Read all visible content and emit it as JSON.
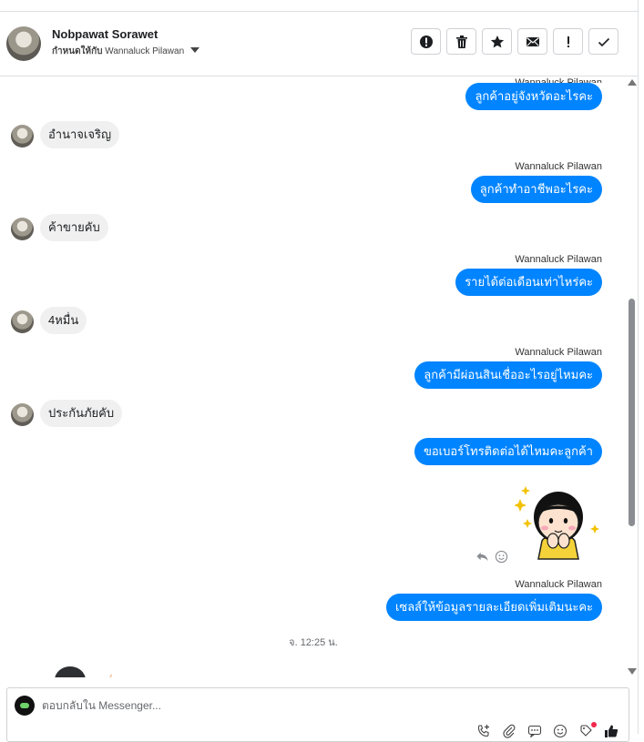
{
  "header": {
    "name": "Nobpawat Sorawet",
    "assign_label": "กำหนดให้กับ",
    "assignee": "Wannaluck Pilawan"
  },
  "actions": [
    {
      "icon": "spam-alert-icon"
    },
    {
      "icon": "trash-icon"
    },
    {
      "icon": "star-icon"
    },
    {
      "icon": "mail-icon"
    },
    {
      "icon": "exclamation-icon"
    },
    {
      "icon": "check-icon"
    }
  ],
  "conversation": {
    "partial_sender": "Wannaluck Pilawan",
    "messages": [
      {
        "from": "agent",
        "text": "ลูกค้าอยู่จังหวัดอะไรคะ"
      },
      {
        "from": "customer",
        "text": "อำนาจเจริญ"
      },
      {
        "from": "agent",
        "sender": "Wannaluck Pilawan",
        "text": "ลูกค้าทำอาชีพอะไรคะ"
      },
      {
        "from": "customer",
        "text": "ค้าขายคับ"
      },
      {
        "from": "agent",
        "sender": "Wannaluck Pilawan",
        "text": "รายได้ต่อเดือนเท่าไหร่คะ"
      },
      {
        "from": "customer",
        "text": "4หมื่น"
      },
      {
        "from": "agent",
        "sender": "Wannaluck Pilawan",
        "text": "ลูกค้ามีผ่อนสินเชื่ออะไรอยู่ไหมคะ"
      },
      {
        "from": "customer",
        "text": "ประกันภัยคับ"
      },
      {
        "from": "agent",
        "text": "ขอเบอร์โทรติดต่อได้ไหมคะลูกค้า"
      },
      {
        "from": "agent",
        "sender": "Wannaluck Pilawan",
        "text": "เซลส์ให้ข้อมูลรายละเอียดเพิ่มเติมนะคะ"
      }
    ],
    "timestamp": "จ. 12:25 น."
  },
  "composer": {
    "placeholder": "ตอบกลับใน Messenger..."
  },
  "colors": {
    "outgoing_bubble": "#0084ff",
    "incoming_bubble": "#f0f0f0"
  }
}
